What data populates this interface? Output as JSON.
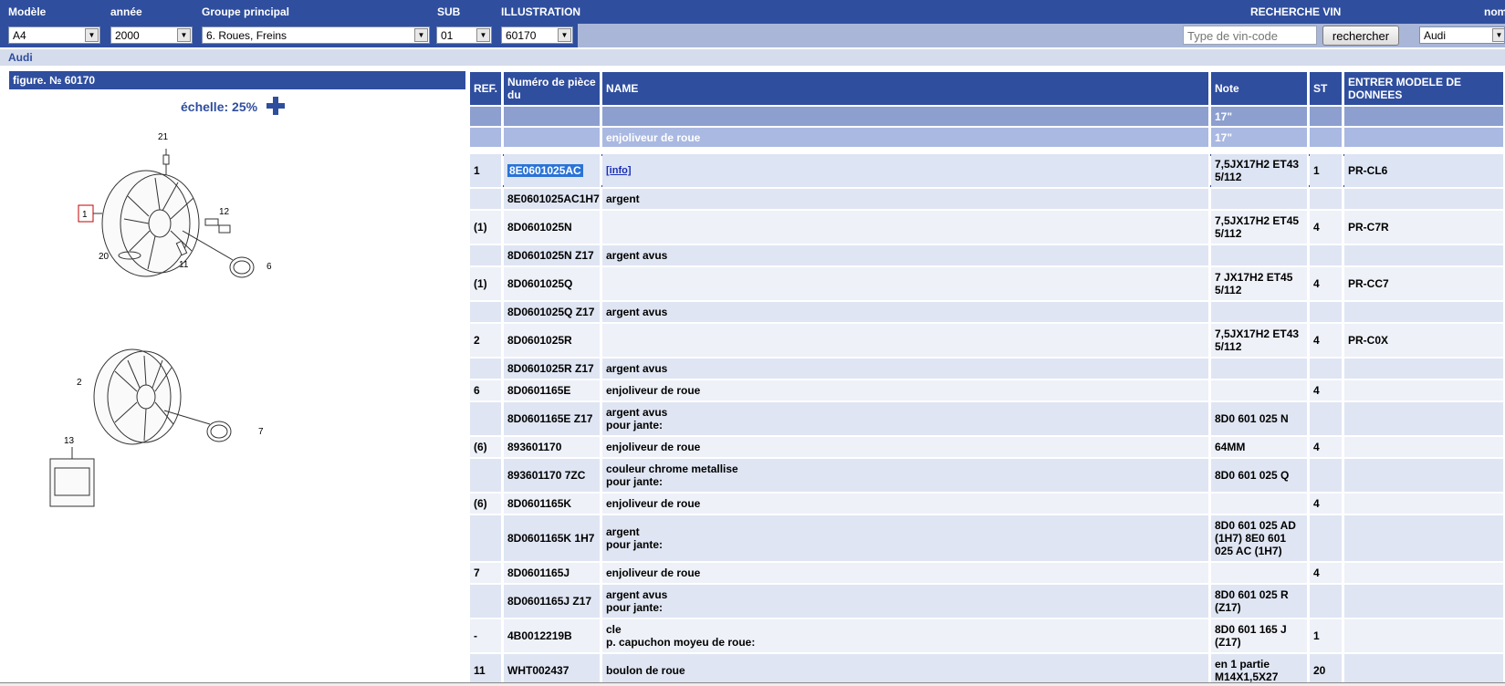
{
  "toolbar": {
    "labels": {
      "modele": "Modèle",
      "annee": "année",
      "groupe": "Groupe principal",
      "sub": "SUB",
      "illustration": "ILLUSTRATION",
      "recherche_vin": "RECHERCHE VIN",
      "nom": "nom"
    },
    "values": {
      "modele": "A4",
      "annee": "2000",
      "groupe": "6. Roues, Freins",
      "sub": "01",
      "illustration": "60170",
      "brand": "Audi"
    },
    "vin_placeholder": "Type de vin-code",
    "search_button": "rechercher"
  },
  "breadcrumb": "Audi",
  "figure": {
    "title": "figure. № 60170",
    "scale_label": "échelle: 25%",
    "callouts": [
      "21",
      "1",
      "12",
      "20",
      "11",
      "6",
      "2",
      "7",
      "13"
    ]
  },
  "table": {
    "headers": [
      "REF.",
      "Numéro de pièce du",
      "NAME",
      "Note",
      "ST",
      "ENTRER MODELE DE DONNEES"
    ],
    "bands": [
      {
        "ref": "",
        "pn": "",
        "name": "",
        "note": "17\"",
        "st": "",
        "model": ""
      },
      {
        "ref": "",
        "pn": "",
        "name": "enjoliveur de roue",
        "note": "17\"",
        "st": "",
        "model": ""
      }
    ],
    "rows": [
      {
        "ref": "1",
        "pn": "8E0601025AC",
        "name": "[info]",
        "note": "7,5JX17H2 ET43\n5/112",
        "st": "1",
        "model": "PR-CL6"
      },
      {
        "ref": "",
        "pn": "8E0601025AC1H7",
        "name": "argent",
        "note": "",
        "st": "",
        "model": ""
      },
      {
        "ref": "(1)",
        "pn": "8D0601025N",
        "name": "",
        "note": "7,5JX17H2 ET45\n5/112",
        "st": "4",
        "model": "PR-C7R"
      },
      {
        "ref": "",
        "pn": "8D0601025N Z17",
        "name": "argent avus",
        "note": "",
        "st": "",
        "model": ""
      },
      {
        "ref": "(1)",
        "pn": "8D0601025Q",
        "name": "",
        "note": "7 JX17H2 ET45\n5/112",
        "st": "4",
        "model": "PR-CC7"
      },
      {
        "ref": "",
        "pn": "8D0601025Q Z17",
        "name": "argent avus",
        "note": "",
        "st": "",
        "model": ""
      },
      {
        "ref": "2",
        "pn": "8D0601025R",
        "name": "",
        "note": "7,5JX17H2 ET43\n5/112",
        "st": "4",
        "model": "PR-C0X"
      },
      {
        "ref": "",
        "pn": "8D0601025R Z17",
        "name": "argent avus",
        "note": "",
        "st": "",
        "model": ""
      },
      {
        "ref": "6",
        "pn": "8D0601165E",
        "name": "enjoliveur de roue",
        "note": "",
        "st": "4",
        "model": ""
      },
      {
        "ref": "",
        "pn": "8D0601165E Z17",
        "name": "argent avus\npour jante:",
        "note": "8D0 601 025 N",
        "st": "",
        "model": ""
      },
      {
        "ref": "(6)",
        "pn": "893601170",
        "name": "enjoliveur de roue",
        "note": "64MM",
        "st": "4",
        "model": ""
      },
      {
        "ref": "",
        "pn": "893601170 7ZC",
        "name": "couleur chrome metallise\npour jante:",
        "note": "8D0 601 025 Q",
        "st": "",
        "model": ""
      },
      {
        "ref": "(6)",
        "pn": "8D0601165K",
        "name": "enjoliveur de roue",
        "note": "",
        "st": "4",
        "model": ""
      },
      {
        "ref": "",
        "pn": "8D0601165K 1H7",
        "name": "argent\npour jante:",
        "note": "8D0 601 025 AD\n(1H7) 8E0 601\n025 AC (1H7)",
        "st": "",
        "model": ""
      },
      {
        "ref": "7",
        "pn": "8D0601165J",
        "name": "enjoliveur de roue",
        "note": "",
        "st": "4",
        "model": ""
      },
      {
        "ref": "",
        "pn": "8D0601165J Z17",
        "name": "argent avus\npour jante:",
        "note": "8D0 601 025 R\n(Z17)",
        "st": "",
        "model": ""
      },
      {
        "ref": "-",
        "pn": "4B0012219B",
        "name": "cle\np. capuchon moyeu de roue:",
        "note": "8D0 601 165 J\n(Z17)",
        "st": "1",
        "model": ""
      },
      {
        "ref": "11",
        "pn": "WHT002437",
        "name": "boulon de roue",
        "note": "en 1 partie\nM14X1,5X27",
        "st": "20",
        "model": ""
      }
    ]
  }
}
